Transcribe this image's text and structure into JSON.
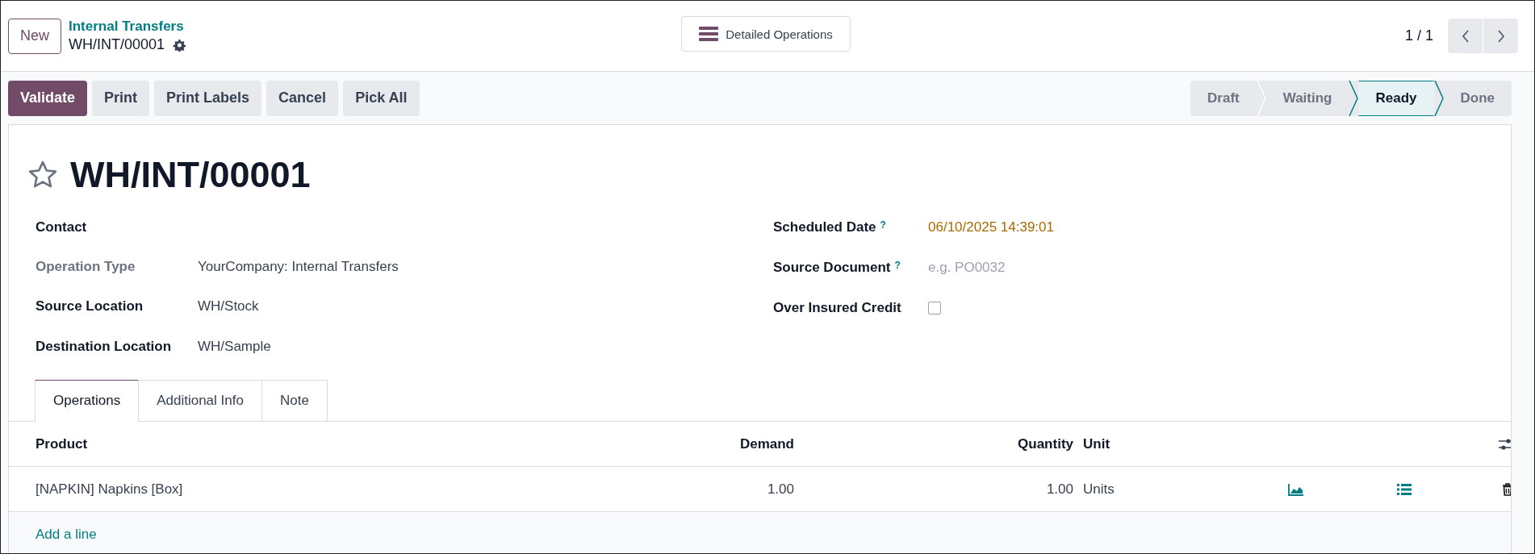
{
  "control_panel": {
    "new_button": "New",
    "breadcrumb": "Internal Transfers",
    "record_name": "WH/INT/00001",
    "view_button": "Detailed Operations",
    "pager": "1 / 1"
  },
  "actions": [
    {
      "label": "Validate",
      "primary": true
    },
    {
      "label": "Print",
      "primary": false
    },
    {
      "label": "Print Labels",
      "primary": false
    },
    {
      "label": "Cancel",
      "primary": false
    },
    {
      "label": "Pick All",
      "primary": false
    }
  ],
  "statusbar": [
    {
      "label": "Draft",
      "selected": false
    },
    {
      "label": "Waiting",
      "selected": false
    },
    {
      "label": "Ready",
      "selected": true
    },
    {
      "label": "Done",
      "selected": false
    }
  ],
  "form": {
    "title": "WH/INT/00001",
    "starred": false,
    "left_fields": [
      {
        "label": "Contact",
        "kind": "text",
        "readonly": false
      },
      {
        "label": "Operation Type",
        "kind": "text",
        "readonly": true,
        "value": "YourCompany: Internal Transfers"
      },
      {
        "label": "Source Location",
        "kind": "text",
        "readonly": false,
        "value": "WH/Stock"
      },
      {
        "label": "Destination Location",
        "kind": "text",
        "readonly": false,
        "value": "WH/Sample"
      }
    ],
    "right_fields": [
      {
        "label": "Scheduled Date",
        "help": "?",
        "kind": "date",
        "readonly": false,
        "value": "06/10/2025 14:39:01"
      },
      {
        "label": "Source Document",
        "help": "?",
        "kind": "text",
        "readonly": false,
        "placeholder": "e.g. PO0032"
      },
      {
        "label": "Over Insured Credit",
        "kind": "checkbox",
        "readonly": false,
        "checked": false
      }
    ]
  },
  "tabs": [
    {
      "label": "Operations",
      "selected": true
    },
    {
      "label": "Additional Info",
      "selected": false
    },
    {
      "label": "Note",
      "selected": false
    }
  ],
  "table": {
    "columns": [
      "Product",
      "Demand",
      "Quantity",
      "Unit"
    ],
    "rows": [
      {
        "product": "[NAPKIN] Napkins [Box]",
        "demand": "1.00",
        "quantity": "1.00",
        "unit": "Units"
      }
    ],
    "add_line": "Add a line"
  }
}
